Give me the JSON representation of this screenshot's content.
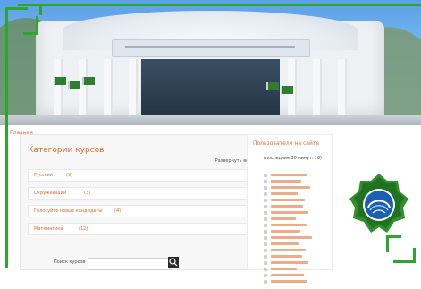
{
  "breadcrumb": {
    "label": "Главная"
  },
  "categories": {
    "title": "Категории курсов",
    "expand_all": "Развернуть всё",
    "items": [
      {
        "label": "Русский",
        "count": "(9)"
      },
      {
        "label": "Окружающий",
        "count": "(3)"
      },
      {
        "label": "Голосуйте новые кандидаты",
        "count": "(4)"
      },
      {
        "label": "Математика",
        "count": "(12)"
      }
    ]
  },
  "search": {
    "label": "Поиск курсов",
    "placeholder": "",
    "button_icon": "search-icon"
  },
  "online_users": {
    "title": "Пользователи на сайте",
    "subtitle": "(последние 30 минут: 18)"
  },
  "logo": {
    "icon": "university-logo"
  },
  "colors": {
    "accent": "#e06b2e",
    "frame": "#2fa52f"
  }
}
